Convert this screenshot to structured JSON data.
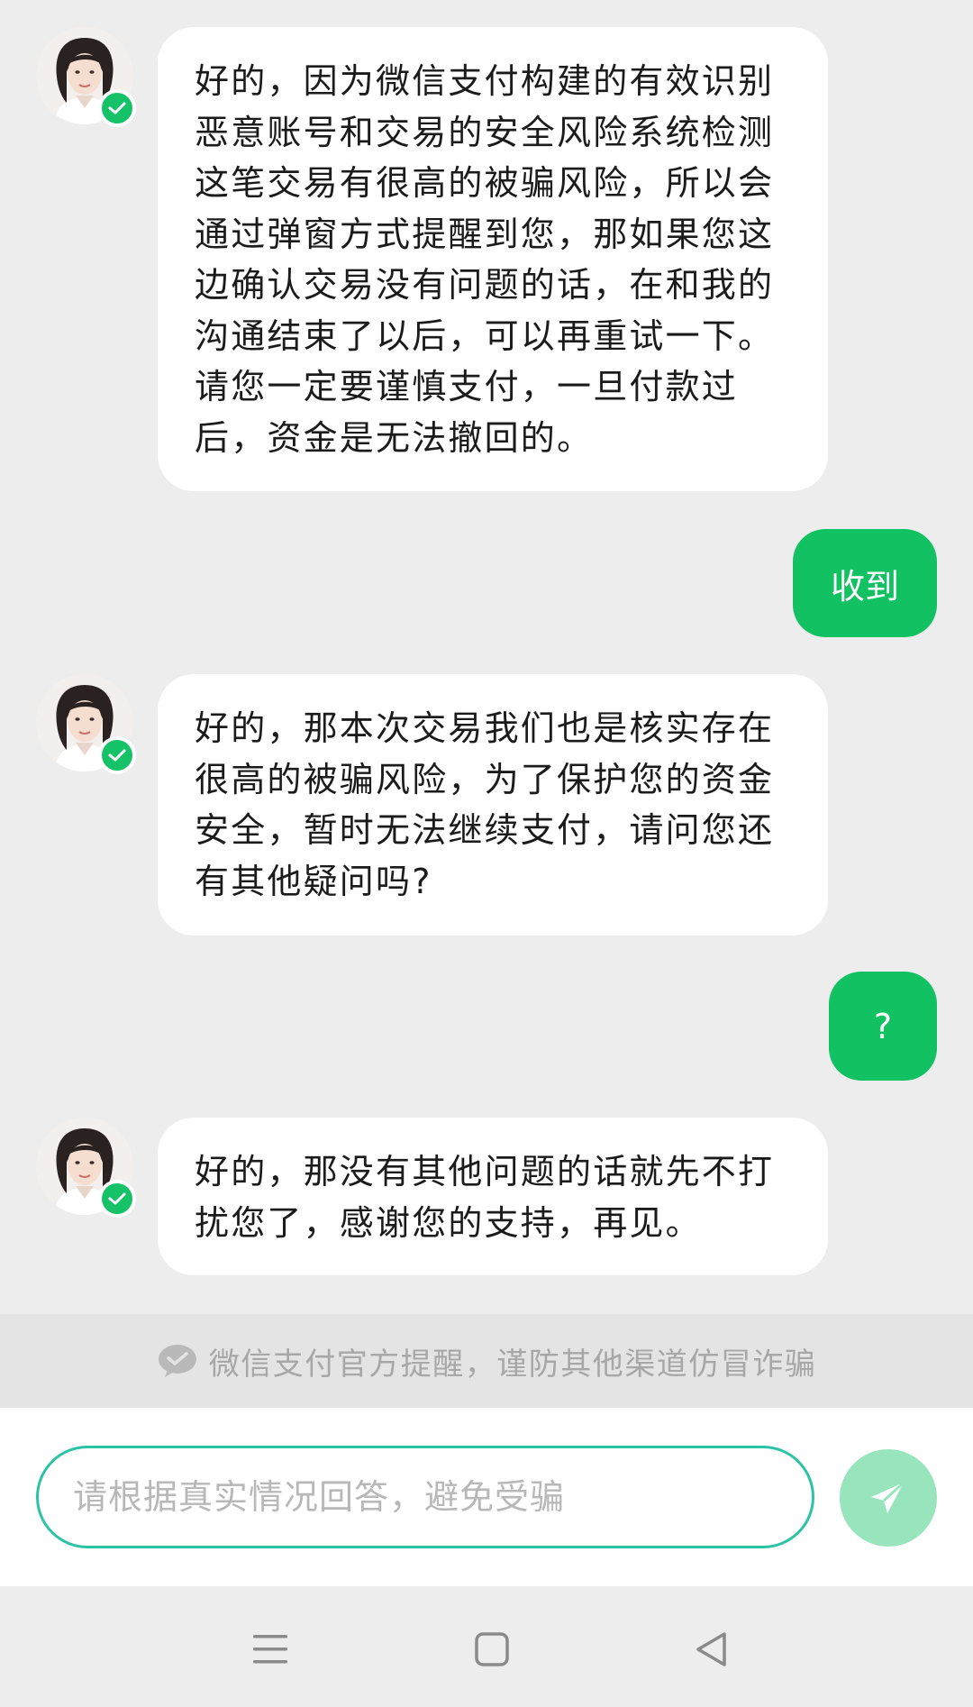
{
  "messages": [
    {
      "sender": "agent",
      "text": "好的，因为微信支付构建的有效识别\n恶意账号和交易的安全风险系统检测\n这笔交易有很高的被骗风险，所以会\n通过弹窗方式提醒到您，那如果您这\n边确认交易没有问题的话，在和我的\n沟通结束了以后，可以再重试一下。\n请您一定要谨慎支付，一旦付款过\n后，资金是无法撤回的。"
    },
    {
      "sender": "user",
      "text": "收到"
    },
    {
      "sender": "agent",
      "text": "好的，那本次交易我们也是核实存在\n很高的被骗风险，为了保护您的资金\n安全，暂时无法继续支付，请问您还\n有其他疑问吗?"
    },
    {
      "sender": "user",
      "text": "?"
    },
    {
      "sender": "agent",
      "text": "好的，那没有其他问题的话就先不打\n扰您了，感谢您的支持，再见。"
    }
  ],
  "notice": {
    "icon": "wechat-pay-icon",
    "text": "微信支付官方提醒，谨防其他渠道仿冒诈骗"
  },
  "input": {
    "placeholder": "请根据真实情况回答，避免受骗",
    "value": ""
  },
  "send_button": {
    "icon": "send-icon"
  },
  "navbar": {
    "icons": [
      "menu-icon",
      "home-square-icon",
      "back-triangle-icon"
    ]
  },
  "colors": {
    "background": "#ededed",
    "user_bubble": "#11c162",
    "agent_bubble": "#ffffff",
    "verified_badge": "#15c268",
    "input_border": "#2cc3a5",
    "send_button": "#98e5bd"
  }
}
